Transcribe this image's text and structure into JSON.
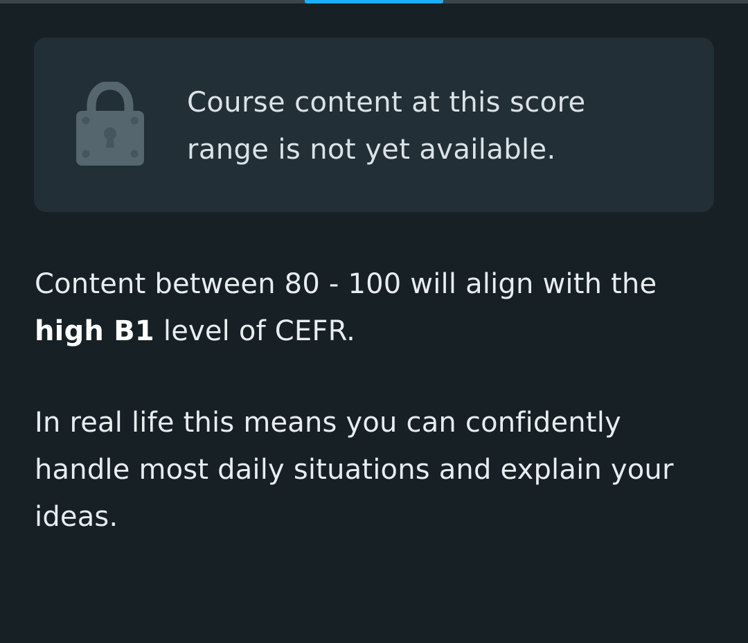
{
  "progress": {
    "fraction": 0.185,
    "offset_fraction": 0.407,
    "color": "#1cb0f6"
  },
  "locked_card": {
    "icon": "lock-icon",
    "message": "Course content at this score range is not yet available."
  },
  "info": {
    "range_prefix": "Content between 80 - 100 will align with the",
    "level": "high B1",
    "range_suffix": "level of CEFR.",
    "real_life": "In real life this means you can confidently handle most daily situations and explain your ideas."
  },
  "colors": {
    "background": "#172025",
    "card": "#232f36",
    "accent": "#1cb0f6"
  }
}
